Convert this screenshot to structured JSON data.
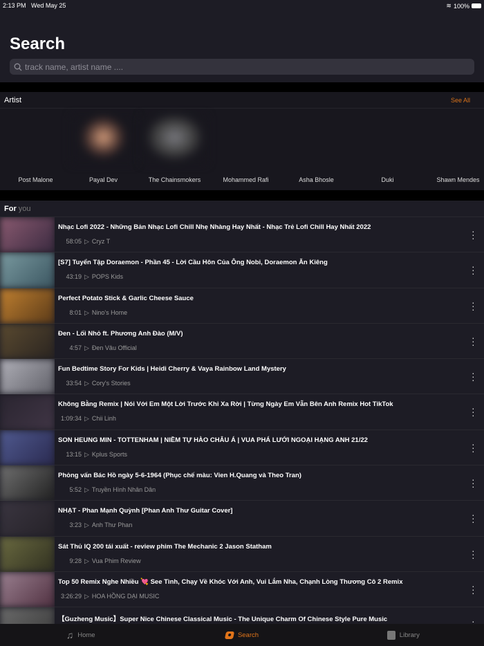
{
  "status": {
    "time": "2:13 PM",
    "date": "Wed May 25",
    "battery": "100%"
  },
  "header": {
    "title": "Search",
    "search_placeholder": "track name, artist name ...."
  },
  "artist_section": {
    "title": "Artist",
    "see_all": "See All",
    "artists": [
      "Post Malone",
      "Payal Dev",
      "The Chainsmokers",
      "Mohammed Rafi",
      "Asha Bhosle",
      "Duki",
      "Shawn Mendes"
    ]
  },
  "for_you": {
    "title": "For",
    "title_suffix": "you",
    "tracks": [
      {
        "title": "Nhạc Lofi 2022 - Những Bản Nhạc Lofi Chill Nhẹ Nhàng Hay Nhất - Nhạc Trẻ Lofi Chill Hay Nhất 2022",
        "duration": "58:05",
        "channel": "Cryz T"
      },
      {
        "title": "[S7] Tuyển Tập Doraemon - Phần 45 - Lời Cầu Hôn Của Ông Nobi, Doraemon Ăn Kiêng",
        "duration": "43:19",
        "channel": "POPS Kids"
      },
      {
        "title": "Perfect Potato Stick & Garlic Cheese Sauce",
        "duration": "8:01",
        "channel": "Nino's Home"
      },
      {
        "title": "Đen - Lối Nhỏ ft. Phương Anh Đào (M/V)",
        "duration": "4:57",
        "channel": "Đen Vâu Official"
      },
      {
        "title": "Fun Bedtime Story For Kids | Heidi Cherry & Vaya Rainbow Land Mystery",
        "duration": "33:54",
        "channel": "Cory's Stories"
      },
      {
        "title": "Không Bằng Remix | Nói Với Em Một Lời Trước Khi Xa Rời | Từng Ngày Em Vẫn Bên Anh Remix Hot TikTok",
        "duration": "1:09:34",
        "channel": "Chii Linh"
      },
      {
        "title": "SON HEUNG MIN - TOTTENHAM | NIỀM TỰ HÀO CHÂU Á | VUA PHÁ LƯỚI NGOẠI HẠNG ANH 21/22",
        "duration": "13:15",
        "channel": "Kplus Sports"
      },
      {
        "title": "Phỏng vấn Bác Hồ ngày 5-6-1964 (Phục chế màu: Vien H.Quang và Theo Tran)",
        "duration": "5:52",
        "channel": "Truyền Hình Nhân Dân"
      },
      {
        "title": "NHẠT - Phan Mạnh Quỳnh [Phan Anh Thư Guitar Cover]",
        "duration": "3:23",
        "channel": "Anh Thư Phan"
      },
      {
        "title": "Sát Thủ IQ 200 tái xuất - review phim The Mechanic 2 Jason Statham",
        "duration": "9:28",
        "channel": "Vua Phim Review"
      },
      {
        "title": "Top 50 Remix Nghe Nhiều 💘 See Tình, Chạy Về Khóc Với Anh, Vui Lắm Nha, Chạnh Lòng Thương Cô 2 Remix",
        "duration": "3:26:29",
        "channel": "HOA HỒNG DẠI MUSIC"
      },
      {
        "title": "【Guzheng Music】Super Nice Chinese Classical Music - The Unique Charm Of Chinese Style Pure Music",
        "duration": "",
        "channel": ""
      }
    ]
  },
  "tabbar": {
    "home": "Home",
    "search": "Search",
    "library": "Library"
  },
  "colors": {
    "accent": "#e0741a",
    "background": "#1d1c25"
  }
}
